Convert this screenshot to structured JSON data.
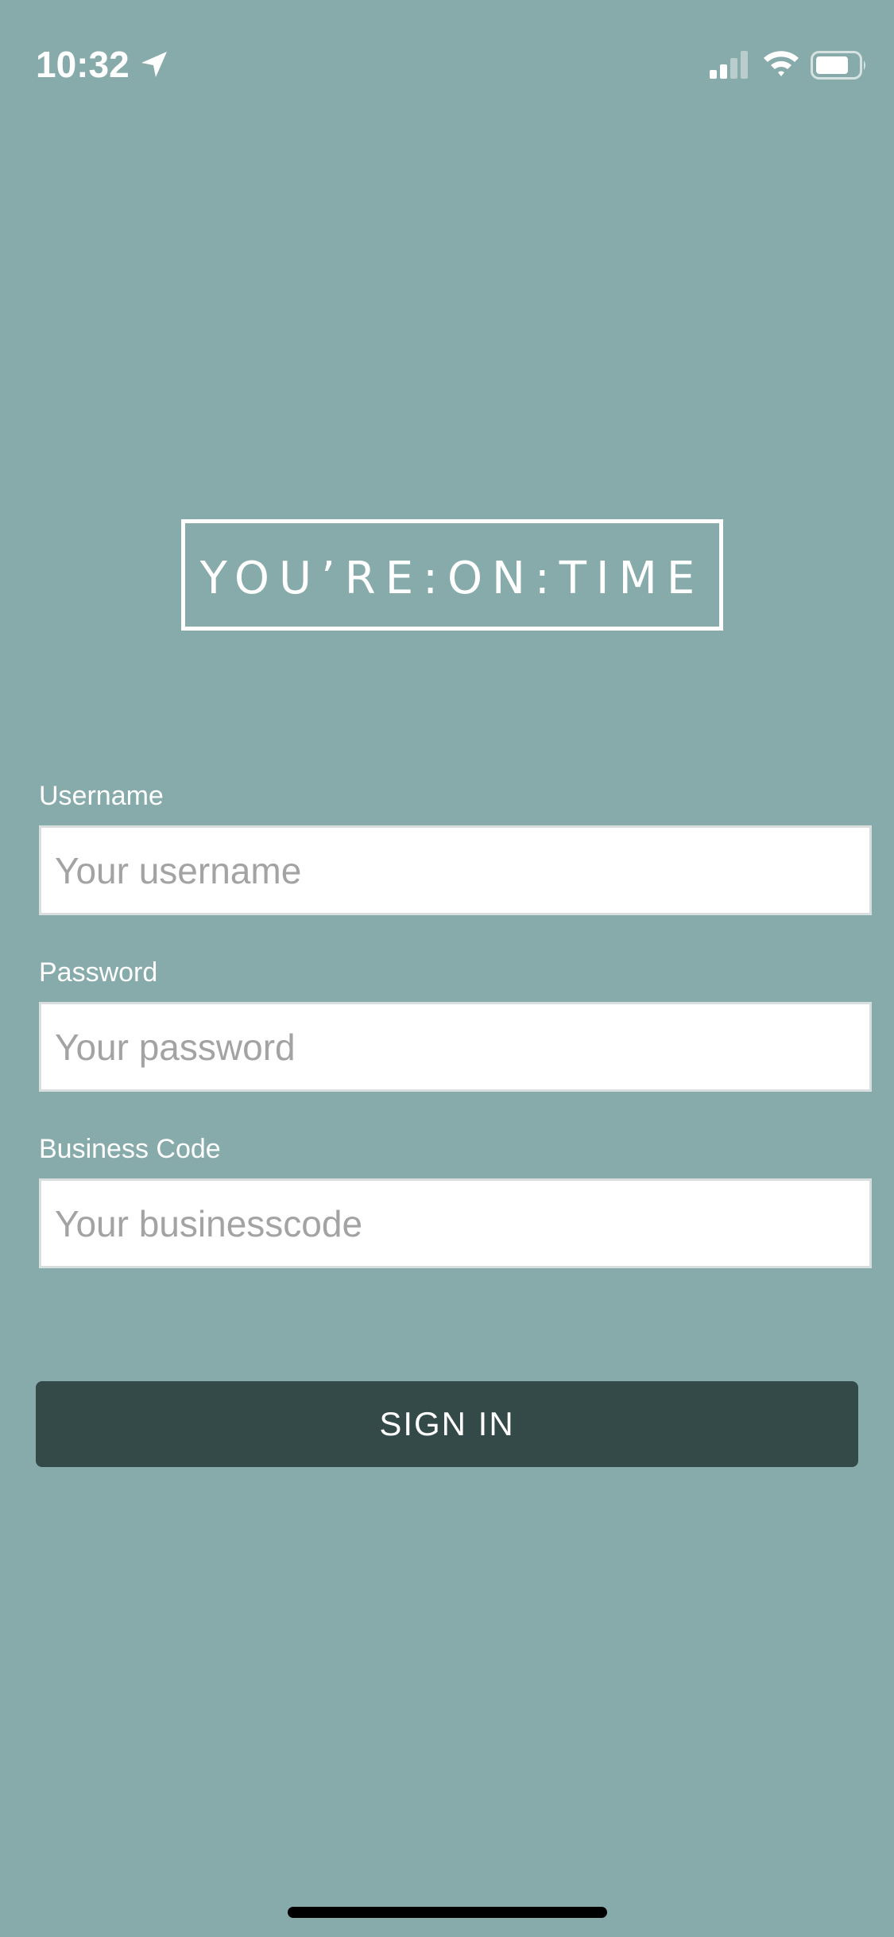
{
  "status_bar": {
    "time": "10:32",
    "icons": [
      "location-arrow-icon",
      "cellular-signal-icon",
      "wifi-icon",
      "battery-icon"
    ]
  },
  "logo": {
    "text": "YOU’RE:ON:TIME"
  },
  "form": {
    "username": {
      "label": "Username",
      "placeholder": "Your username",
      "value": ""
    },
    "password": {
      "label": "Password",
      "placeholder": "Your password",
      "value": ""
    },
    "business_code": {
      "label": "Business Code",
      "placeholder": "Your businesscode",
      "value": ""
    },
    "sign_in_label": "SIGN IN"
  },
  "colors": {
    "background": "#87abaa",
    "button": "#344a48",
    "text_light": "#ffffff",
    "placeholder": "#a3a3a3"
  }
}
